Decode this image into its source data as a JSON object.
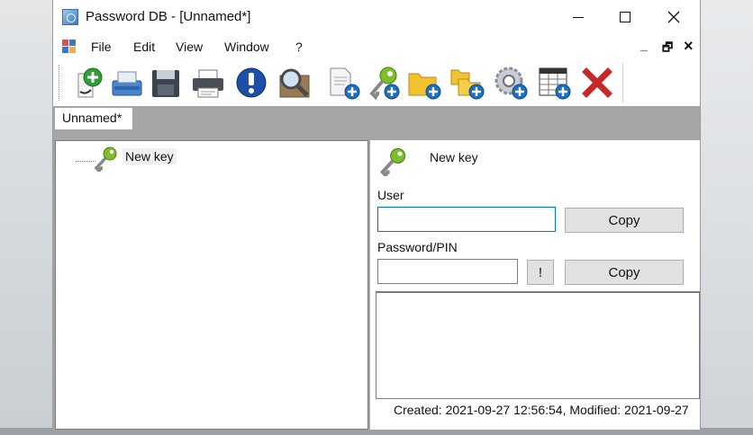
{
  "window": {
    "title": "Password DB - [Unnamed*]"
  },
  "menu": {
    "items": [
      "File",
      "Edit",
      "View",
      "Window",
      "?"
    ],
    "mdi_minimize": "_",
    "mdi_restore": "🗗",
    "mdi_close": "×"
  },
  "toolbar": {
    "buttons": [
      "new-database-icon",
      "open-database-icon",
      "save-database-icon",
      "print-icon",
      "info-icon",
      "search-icon",
      "add-document-icon",
      "add-key-icon",
      "add-folder-icon",
      "add-subfolder-icon",
      "add-link-icon",
      "add-table-icon",
      "delete-icon"
    ]
  },
  "tabs": [
    {
      "label": "Unnamed*"
    }
  ],
  "tree": {
    "items": [
      {
        "label": "New key"
      }
    ]
  },
  "detail": {
    "title": "New key",
    "user_label": "User",
    "user_value": "",
    "password_label": "Password/PIN",
    "password_value": "",
    "reveal_label": "!",
    "copy_user_label": "Copy",
    "copy_password_label": "Copy",
    "notes_value": "",
    "status": "Created: 2021-09-27 12:56:54, Modified: 2021-09-27"
  },
  "colors": {
    "tabstrip": "#a6a6a6",
    "focus_border": "#0078d7",
    "button_face": "#e1e1e1"
  }
}
